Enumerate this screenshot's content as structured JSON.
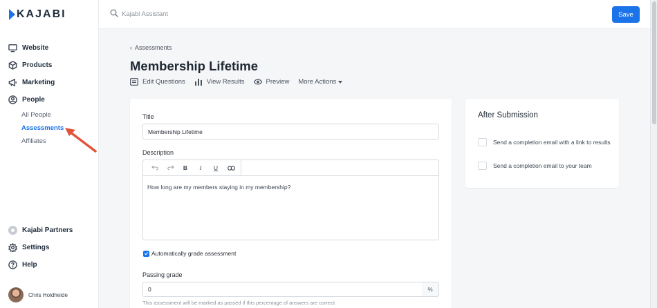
{
  "brand": {
    "name": "KAJABI",
    "accent": "#1a73e8"
  },
  "search": {
    "placeholder": "Kajabi Assistant"
  },
  "header": {
    "save_label": "Save"
  },
  "sidebar": {
    "items": [
      {
        "label": "Website",
        "icon": "monitor-icon"
      },
      {
        "label": "Products",
        "icon": "box-icon"
      },
      {
        "label": "Marketing",
        "icon": "megaphone-icon"
      },
      {
        "label": "People",
        "icon": "person-circle-icon"
      }
    ],
    "sub_items": [
      {
        "label": "All People",
        "active": false
      },
      {
        "label": "Assessments",
        "active": true
      },
      {
        "label": "Affiliates",
        "active": false
      }
    ],
    "bottom_items": [
      {
        "label": "Kajabi Partners",
        "icon": "partners-icon"
      },
      {
        "label": "Settings",
        "icon": "gear-icon"
      },
      {
        "label": "Help",
        "icon": "question-circle-icon"
      }
    ],
    "user_name": "Chris Holdheide"
  },
  "breadcrumb": {
    "label": "Assessments"
  },
  "page": {
    "title": "Membership Lifetime",
    "actions": {
      "edit_questions": "Edit Questions",
      "view_results": "View Results",
      "preview": "Preview",
      "more_actions": "More Actions"
    }
  },
  "form": {
    "title_label": "Title",
    "title_value": "Membership Lifetime",
    "description_label": "Description",
    "description_value": "How long are my members staying in my membership?",
    "toolbar": {
      "bold": "B",
      "italic": "I",
      "underline": "U"
    },
    "auto_grade_label": "Automatically grade assessment",
    "auto_grade_checked": true,
    "passing_grade_label": "Passing grade",
    "passing_grade_value": "0",
    "passing_grade_unit": "%",
    "passing_grade_help": "This assessment will be marked as passed if this percentage of answers are correct"
  },
  "after_submission": {
    "title": "After Submission",
    "options": [
      {
        "label": "Send a completion email with a link to results",
        "checked": false
      },
      {
        "label": "Send a completion email to your team",
        "checked": false
      }
    ]
  }
}
